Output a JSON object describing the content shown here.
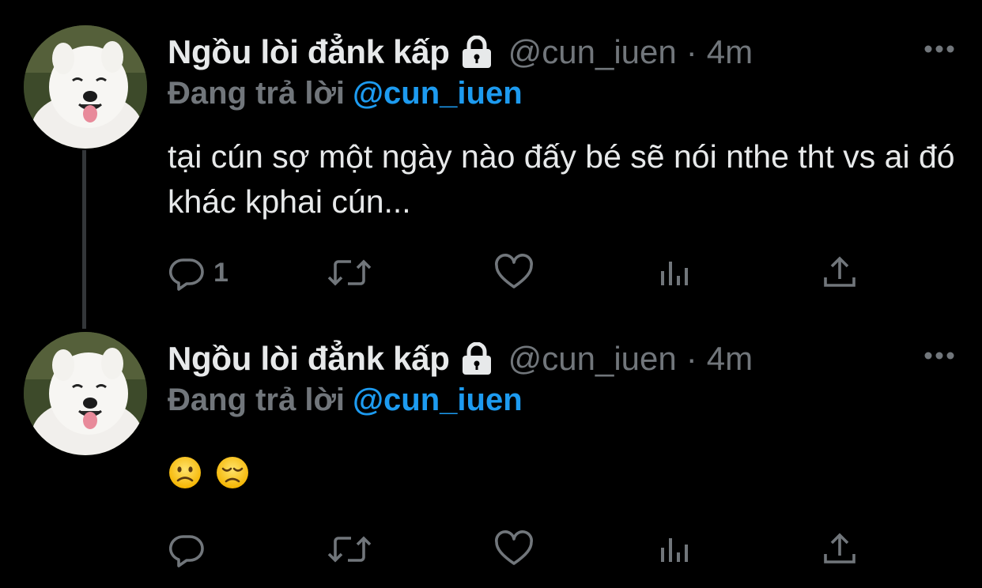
{
  "thread": {
    "tweets": [
      {
        "display_name": "Ngồu lòi đẳnk kấp",
        "handle": "@cun_iuen",
        "separator": "·",
        "time": "4m",
        "reply_prefix": "Đang trả lời",
        "reply_mention": "@cun_iuen",
        "text": "tại cún sợ một ngày nào đấy bé sẽ nói nthe tht vs ai đó khác kphai cún...",
        "reply_count": "1",
        "icons": [
          "lock-icon",
          "more-icon",
          "reply-icon",
          "retweet-icon",
          "like-icon",
          "views-icon",
          "share-icon"
        ]
      },
      {
        "display_name": "Ngồu lòi đẳnk kấp",
        "handle": "@cun_iuen",
        "separator": "·",
        "time": "4m",
        "reply_prefix": "Đang trả lời",
        "reply_mention": "@cun_iuen",
        "emojis": [
          "slightly-frowning-face",
          "disappointed-face"
        ],
        "reply_count": "",
        "icons": [
          "lock-icon",
          "more-icon",
          "reply-icon",
          "retweet-icon",
          "like-icon",
          "views-icon",
          "share-icon"
        ]
      }
    ]
  },
  "colors": {
    "background": "#000000",
    "primary_text": "#e7e9ea",
    "secondary_text": "#71767b",
    "mention": "#1d9bf0",
    "thread_line": "#333639"
  }
}
